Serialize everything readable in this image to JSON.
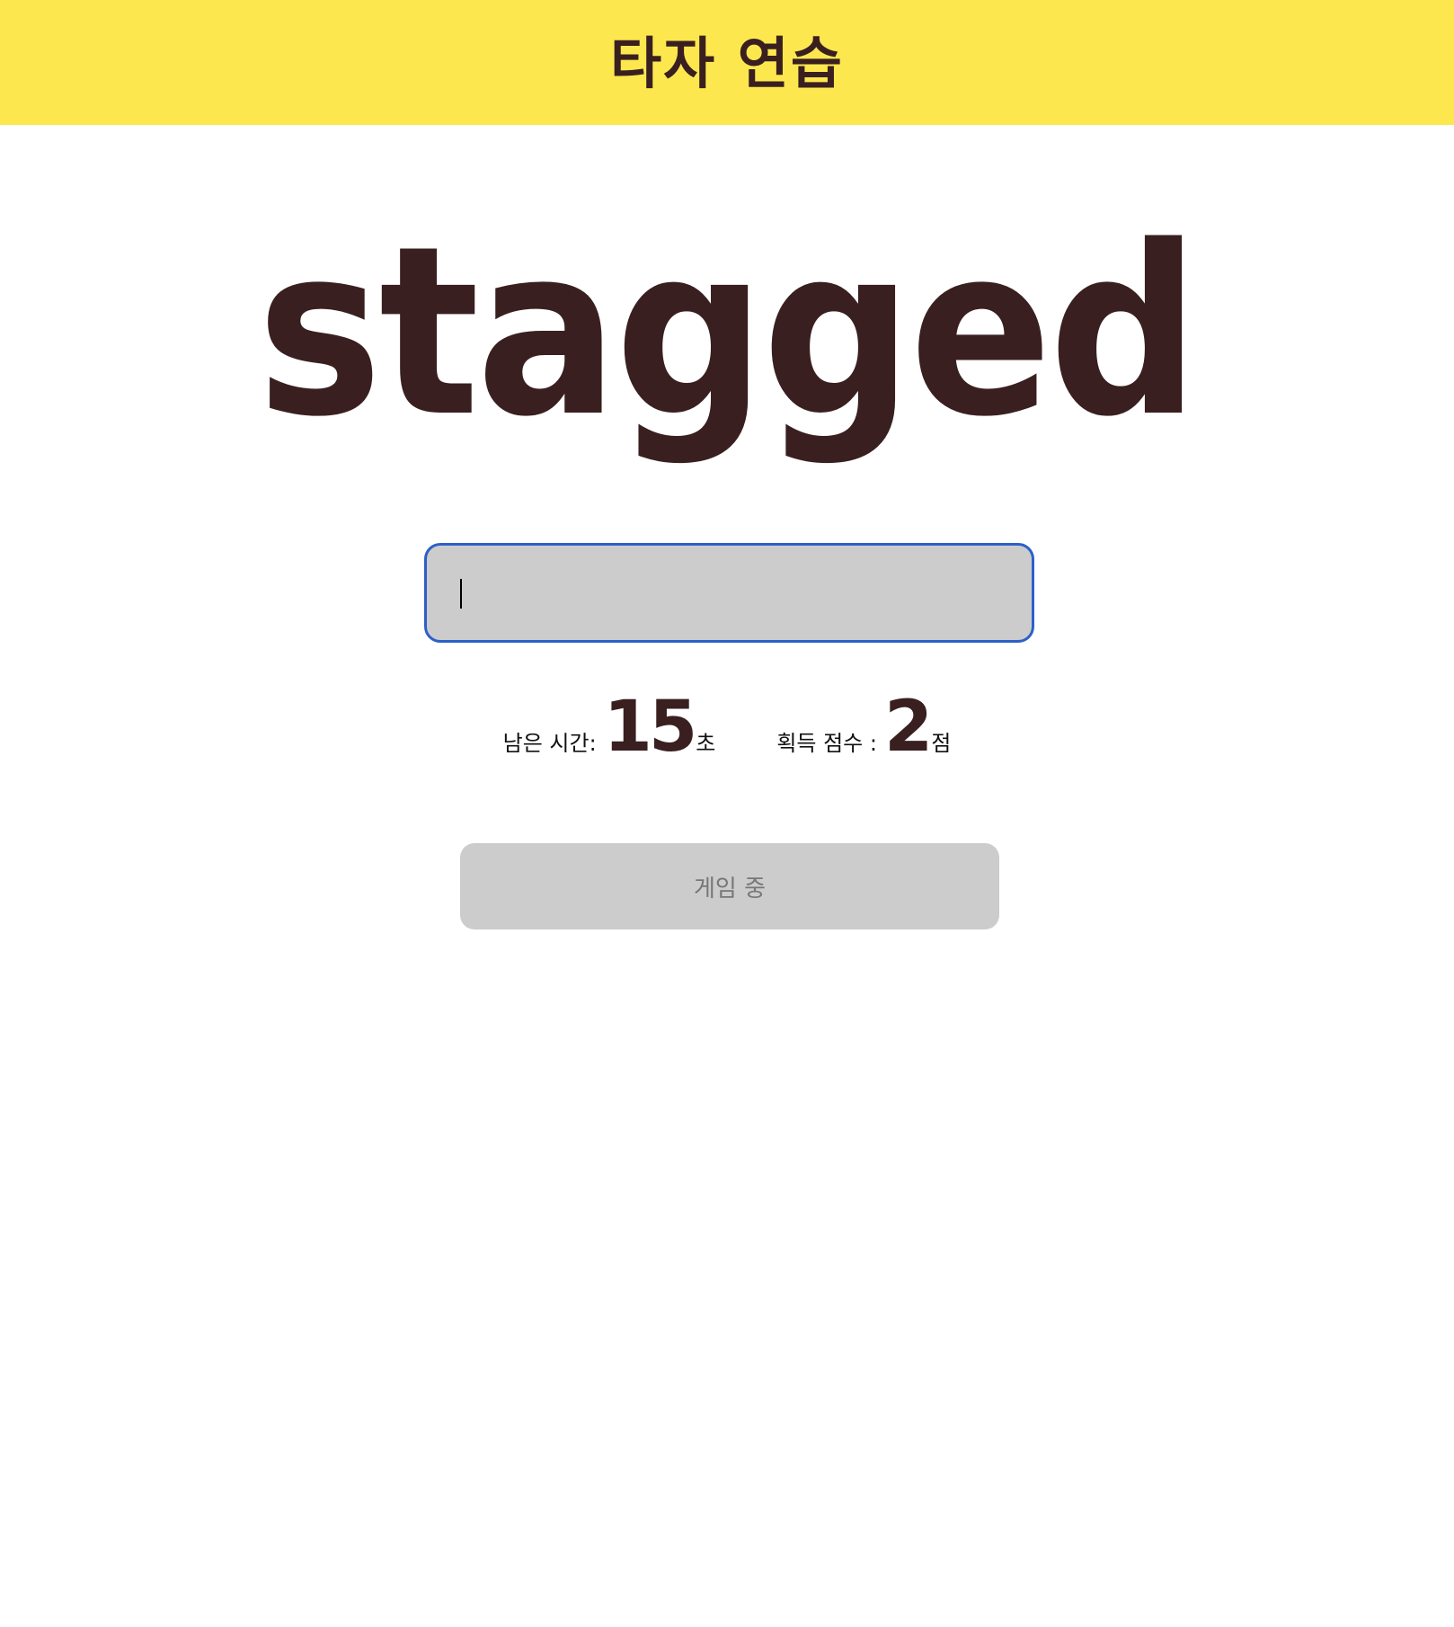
{
  "header": {
    "title": "타자 연습"
  },
  "game": {
    "current_word": "stagged"
  },
  "input": {
    "value": "",
    "placeholder": ""
  },
  "stats": {
    "time_label": "남은 시간:",
    "time_value": "15",
    "time_unit": "초",
    "score_label": "획득 점수 :",
    "score_value": "2",
    "score_unit": "점"
  },
  "button": {
    "label": "게임 중"
  },
  "colors": {
    "header_bg": "#fce84e",
    "text_dark": "#3a1f20",
    "input_border": "#2c60c8",
    "input_bg": "#cccccc",
    "button_bg": "#cccccc",
    "button_text": "#777777"
  }
}
